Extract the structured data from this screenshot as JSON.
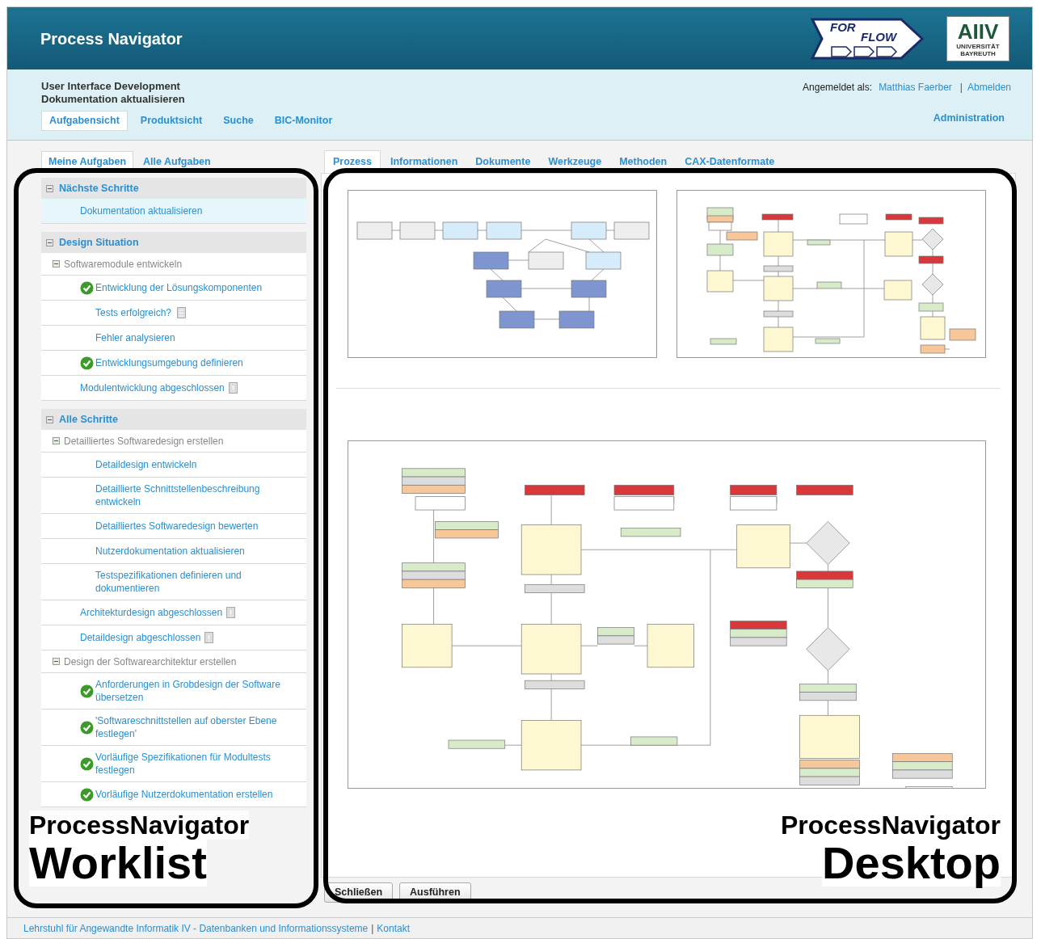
{
  "header": {
    "title": "Process Navigator",
    "logo_left": {
      "line1": "FOR",
      "line2": "FLOW"
    },
    "logo_right": {
      "mark": "AIIV",
      "caption": "UNIVERSITÄT BAYREUTH"
    }
  },
  "context": {
    "project": "User Interface Development",
    "task": "Dokumentation aktualisieren",
    "login_label": "Angemeldet als:",
    "user": "Matthias Faerber",
    "separator": "|",
    "logout": "Abmelden",
    "admin": "Administration"
  },
  "main_nav": [
    {
      "label": "Aufgabensicht",
      "selected": true
    },
    {
      "label": "Produktsicht",
      "selected": false
    },
    {
      "label": "Suche",
      "selected": false
    },
    {
      "label": "BIC-Monitor",
      "selected": false
    }
  ],
  "task_tabs": [
    {
      "label": "Meine Aufgaben",
      "selected": true
    },
    {
      "label": "Alle Aufgaben",
      "selected": false
    }
  ],
  "sections": [
    {
      "title": "Nächste Schritte",
      "expanded": true,
      "items": [
        {
          "kind": "task",
          "label": "Dokumentation aktualisieren",
          "done": false,
          "selected": true
        }
      ]
    },
    {
      "title": "Design Situation",
      "expanded": true,
      "items": [
        {
          "kind": "group",
          "label": "Softwaremodule entwickeln",
          "expanded": true,
          "children": [
            {
              "kind": "task",
              "label": "Entwicklung der Lösungskomponenten",
              "done": true,
              "selected": false
            },
            {
              "kind": "decision",
              "label": "Tests erfolgreich?",
              "done": false,
              "selected": false
            },
            {
              "kind": "task",
              "label": "Fehler analysieren",
              "done": false,
              "selected": false
            },
            {
              "kind": "task",
              "label": "Entwicklungsumgebung definieren",
              "done": true,
              "selected": false
            },
            {
              "kind": "milestone",
              "label": "Modulentwicklung abgeschlossen",
              "selected": false
            }
          ]
        }
      ]
    },
    {
      "title": "Alle Schritte",
      "expanded": true,
      "items": [
        {
          "kind": "group",
          "label": "Detailliertes Softwaredesign erstellen",
          "expanded": true,
          "children": [
            {
              "kind": "task",
              "label": "Detaildesign entwickeln",
              "done": false,
              "selected": false
            },
            {
              "kind": "task",
              "label": "Detaillierte Schnittstellenbeschreibung entwickeln",
              "done": false,
              "selected": false
            },
            {
              "kind": "task",
              "label": "Detailliertes Softwaredesign bewerten",
              "done": false,
              "selected": false
            },
            {
              "kind": "task",
              "label": "Nutzerdokumentation aktualisieren",
              "done": false,
              "selected": false
            },
            {
              "kind": "task",
              "label": "Testspezifikationen definieren und dokumentieren",
              "done": false,
              "selected": false
            },
            {
              "kind": "milestone",
              "label": "Architekturdesign abgeschlossen",
              "selected": false
            },
            {
              "kind": "milestone",
              "label": "Detaildesign abgeschlossen",
              "selected": false
            }
          ]
        },
        {
          "kind": "group",
          "label": "Design der Softwarearchitektur erstellen",
          "expanded": true,
          "children": [
            {
              "kind": "task",
              "label": "Anforderungen in Grobdesign der Software übersetzen",
              "done": true,
              "selected": false
            },
            {
              "kind": "task",
              "label": "'Softwareschnittstellen auf oberster Ebene festlegen'",
              "done": true,
              "selected": false
            },
            {
              "kind": "task",
              "label": "Vorläufige Spezifikationen für Modultests festlegen",
              "done": true,
              "selected": false
            },
            {
              "kind": "task",
              "label": "Vorläufige Nutzerdokumentation erstellen",
              "done": true,
              "selected": false
            }
          ]
        }
      ]
    }
  ],
  "detail_tabs": [
    {
      "label": "Prozess",
      "selected": true
    },
    {
      "label": "Informationen",
      "selected": false
    },
    {
      "label": "Dokumente",
      "selected": false
    },
    {
      "label": "Werkzeuge",
      "selected": false
    },
    {
      "label": "Methoden",
      "selected": false
    },
    {
      "label": "CAX-Datenformate",
      "selected": false
    }
  ],
  "buttons": [
    "Schließen",
    "Ausführen"
  ],
  "footer": {
    "link": "Lehrstuhl für Angewandte Informatik IV - Datenbanken und Informationssysteme",
    "separator": "|",
    "contact": "Kontakt"
  },
  "annotations": [
    {
      "line1": "ProcessNavigator",
      "line2": "Worklist"
    },
    {
      "line1": "ProcessNavigator",
      "line2": "Desktop"
    }
  ]
}
